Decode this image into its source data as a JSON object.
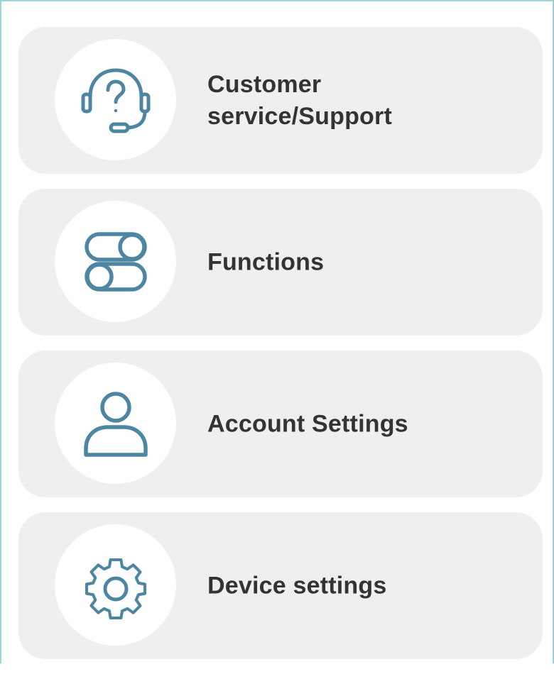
{
  "theme": {
    "accent": "#4d86a2",
    "card_background": "#efefef",
    "text_color": "#333333",
    "frame_border": "#9fd3dc"
  },
  "menu": {
    "items": [
      {
        "id": "customer-service",
        "label": "Customer service/Support",
        "icon": "headset-question-icon"
      },
      {
        "id": "functions",
        "label": "Functions",
        "icon": "toggle-switches-icon"
      },
      {
        "id": "account-settings",
        "label": "Account Settings",
        "icon": "user-icon"
      },
      {
        "id": "device-settings",
        "label": "Device settings",
        "icon": "gear-icon"
      }
    ]
  }
}
